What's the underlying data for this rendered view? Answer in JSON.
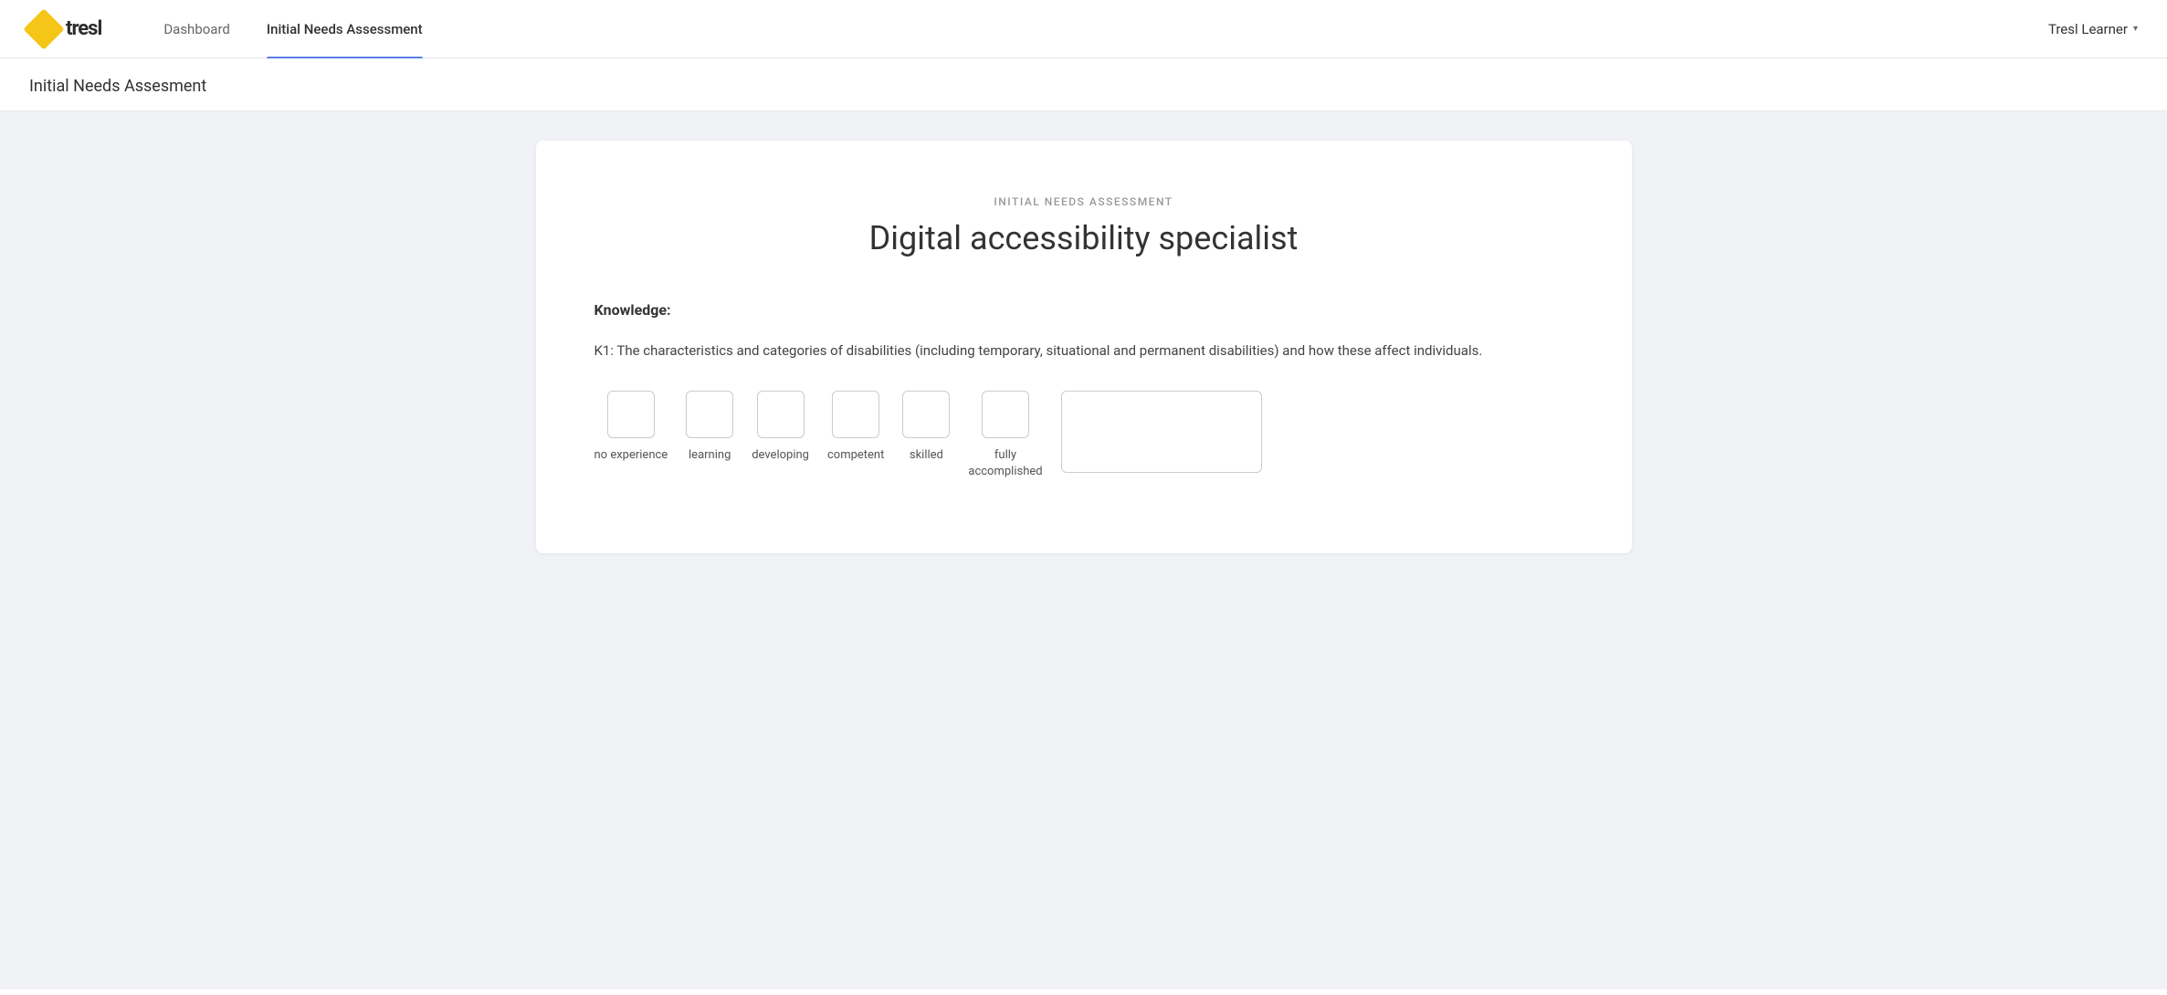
{
  "brand": {
    "logo_text": "tresl",
    "logo_icon": "diamond"
  },
  "nav": {
    "links": [
      {
        "id": "dashboard",
        "label": "Dashboard",
        "active": false
      },
      {
        "id": "initial-needs-assessment",
        "label": "Initial Needs Assessment",
        "active": true
      }
    ],
    "user": {
      "name": "Tresl Learner",
      "chevron": "▾"
    }
  },
  "page_header": {
    "title": "Initial Needs Assesment"
  },
  "assessment": {
    "subtitle": "INITIAL NEEDS ASSESSMENT",
    "title": "Digital accessibility specialist",
    "section_label": "Knowledge:",
    "question": {
      "id": "K1",
      "text": "K1: The characteristics and categories of disabilities (including temporary, situational and permanent disabilities) and how these affect individuals."
    },
    "rating_options": [
      {
        "id": "no-experience",
        "label": "no experience"
      },
      {
        "id": "learning",
        "label": "learning"
      },
      {
        "id": "developing",
        "label": "developing"
      },
      {
        "id": "competent",
        "label": "competent"
      },
      {
        "id": "skilled",
        "label": "skilled"
      },
      {
        "id": "fully-accomplished",
        "label": "fully\naccomplished"
      }
    ],
    "textarea_placeholder": ""
  }
}
